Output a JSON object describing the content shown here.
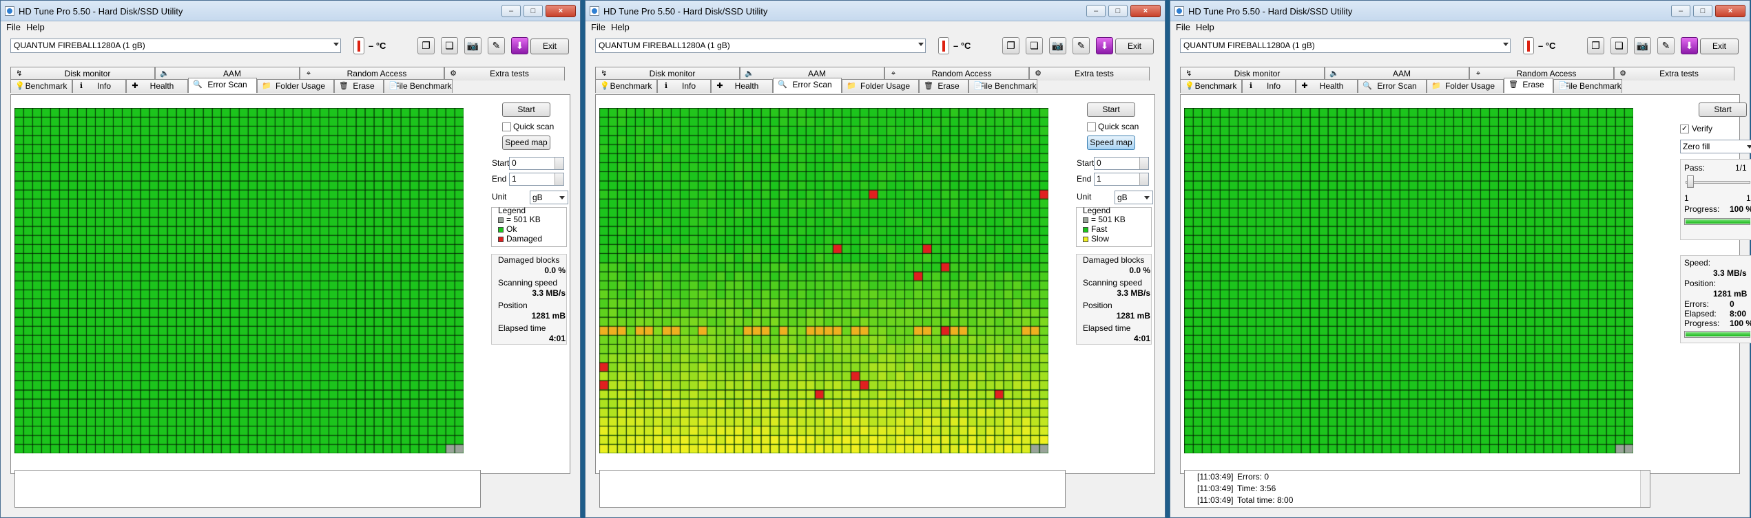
{
  "app": {
    "title": "HD Tune Pro 5.50 - Hard Disk/SSD Utility",
    "menu": [
      "File",
      "Help"
    ],
    "drive": "QUANTUM FIREBALL1280A (1 gB)",
    "temp": "– °C",
    "exit": "Exit"
  },
  "tabs_row1": [
    "Disk monitor",
    "AAM",
    "Random Access",
    "Extra tests"
  ],
  "tabs_row2": [
    "Benchmark",
    "Info",
    "Health",
    "Error Scan",
    "Folder Usage",
    "Erase",
    "File Benchmark"
  ],
  "colors": {
    "ok": "#1cc41c",
    "damaged": "#e02020",
    "fast": "#1cc41c",
    "slow": "#f0f020",
    "block": "#9aa49a"
  },
  "icons": [
    "copy-icon",
    "copy-text-icon",
    "camera-icon",
    "options-icon",
    "save-icon"
  ],
  "win1": {
    "active_tab": "Error Scan",
    "start": "Start",
    "quick_scan": "Quick scan",
    "speed_map": "Speed map",
    "start_label": "Start",
    "start_val": "0",
    "end_label": "End",
    "end_val": "1",
    "unit_label": "Unit",
    "unit_val": "gB",
    "legend_title": "Legend",
    "legend": [
      "= 501 KB",
      "Ok",
      "Damaged"
    ],
    "stats": [
      {
        "label": "Damaged blocks",
        "value": "0.0 %"
      },
      {
        "label": "Scanning speed",
        "value": "3.3 MB/s"
      },
      {
        "label": "Position",
        "value": "1281 mB"
      },
      {
        "label": "Elapsed time",
        "value": "4:01"
      }
    ]
  },
  "win2": {
    "active_tab": "Error Scan",
    "start": "Start",
    "quick_scan": "Quick scan",
    "speed_map": "Speed map",
    "start_label": "Start",
    "start_val": "0",
    "end_label": "End",
    "end_val": "1",
    "unit_label": "Unit",
    "unit_val": "gB",
    "legend_title": "Legend",
    "legend": [
      "= 501 KB",
      "Fast",
      "Slow"
    ],
    "stats": [
      {
        "label": "Damaged blocks",
        "value": "0.0 %"
      },
      {
        "label": "Scanning speed",
        "value": "3.3 MB/s"
      },
      {
        "label": "Position",
        "value": "1281 mB"
      },
      {
        "label": "Elapsed time",
        "value": "4:01"
      }
    ]
  },
  "win3": {
    "active_tab": "Erase",
    "start": "Start",
    "verify": "Verify",
    "verify_checked": true,
    "fill": "Zero fill",
    "pass_label": "Pass:",
    "pass_val": "1/1",
    "slider_min": "1",
    "slider_max": "1",
    "progress_label": "Progress:",
    "progress_val": "100 %",
    "progress": 1.0,
    "speed_label": "Speed:",
    "speed_val": "3.3 MB/s",
    "position_label": "Position:",
    "position_val": "1281 mB",
    "errors_label": "Errors:",
    "errors_val": "0",
    "elapsed_label": "Elapsed:",
    "elapsed_val": "8:00",
    "progress2_label": "Progress:",
    "progress2_val": "100 %",
    "progress2": 1.0,
    "log": [
      {
        "time": "[11:03:49]",
        "text": "Errors: 0"
      },
      {
        "time": "[11:03:49]",
        "text": "Time: 3:56"
      },
      {
        "time": "[11:03:49]",
        "text": "Total time: 8:00"
      }
    ]
  }
}
